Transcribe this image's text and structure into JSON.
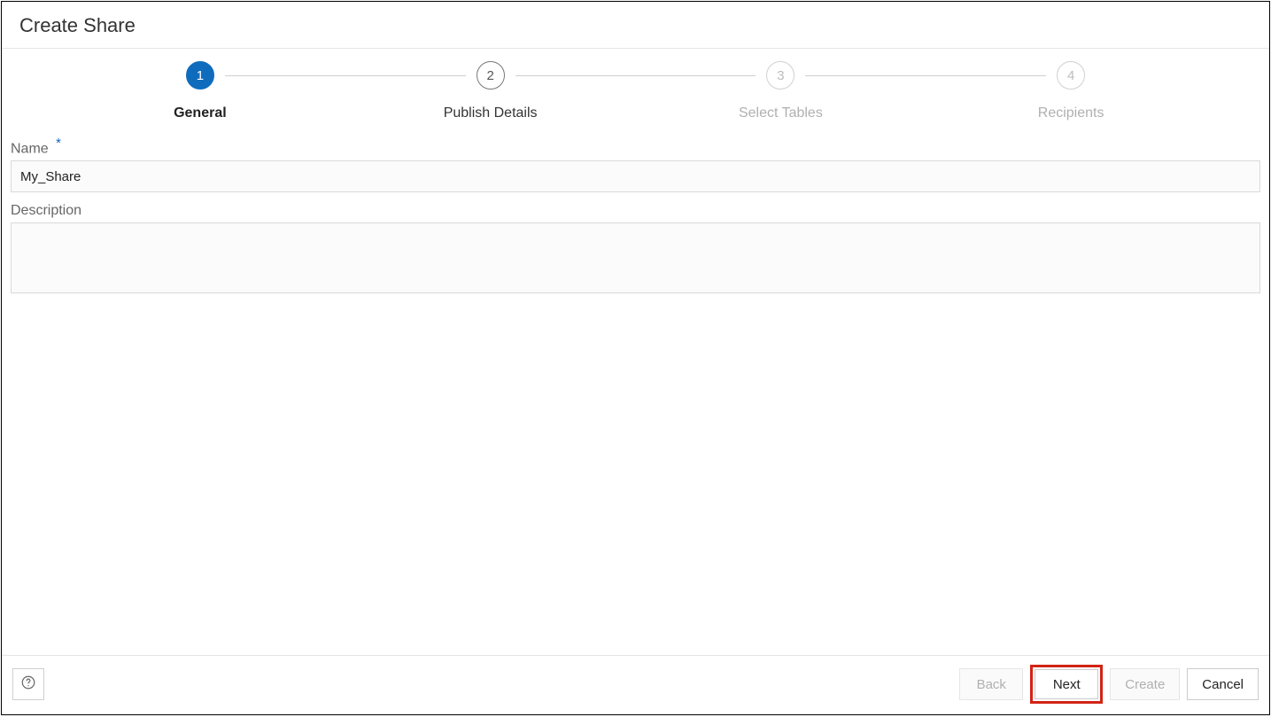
{
  "header": {
    "title": "Create Share"
  },
  "stepper": {
    "steps": [
      {
        "num": "1",
        "label": "General",
        "state": "active"
      },
      {
        "num": "2",
        "label": "Publish Details",
        "state": "pending"
      },
      {
        "num": "3",
        "label": "Select Tables",
        "state": "ghost"
      },
      {
        "num": "4",
        "label": "Recipients",
        "state": "ghost"
      }
    ]
  },
  "form": {
    "name_label": "Name",
    "name_required": "*",
    "name_value": "My_Share",
    "description_label": "Description",
    "description_value": ""
  },
  "footer": {
    "back": "Back",
    "next": "Next",
    "create": "Create",
    "cancel": "Cancel"
  }
}
